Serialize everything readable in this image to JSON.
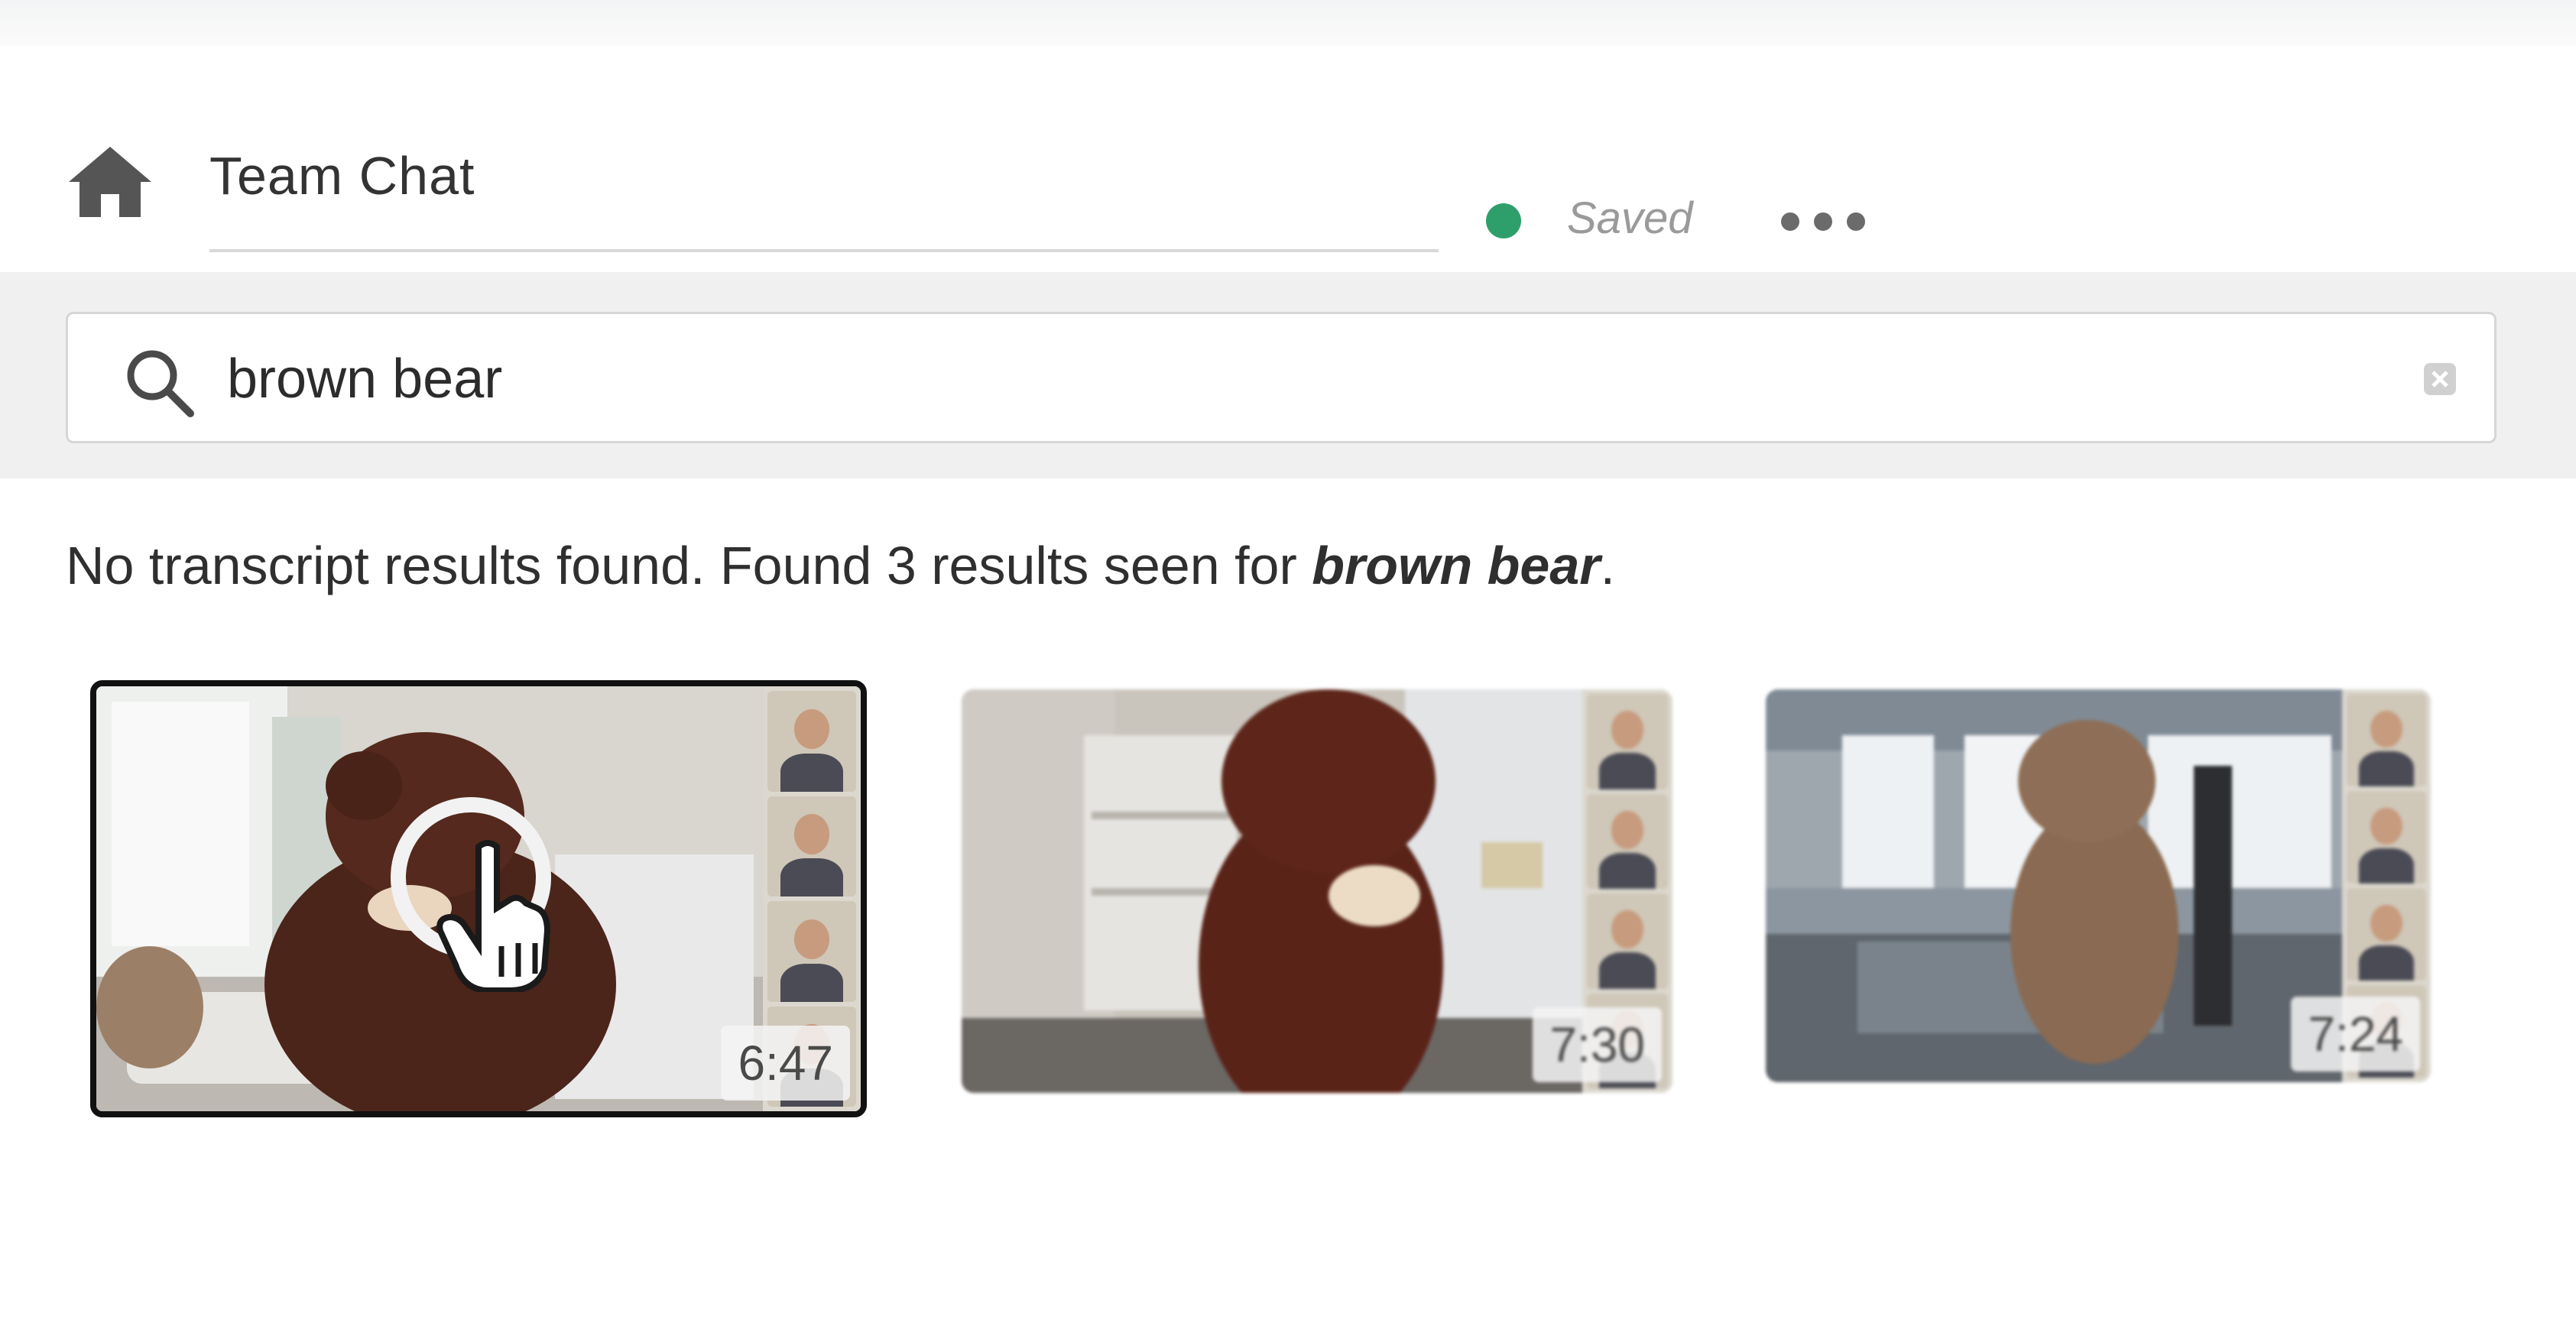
{
  "header": {
    "title": "Team Chat",
    "status_label": "Saved",
    "status_color": "#2e9f6b",
    "home_icon": "home-icon",
    "more_icon": "more-horizontal-icon"
  },
  "search": {
    "value": "brown bear",
    "icon": "search-icon",
    "clear_icon": "close-icon"
  },
  "results": {
    "message_prefix": "No transcript results found. Found 3 results seen for ",
    "query_emphasis": "brown bear",
    "message_suffix": "."
  },
  "videos": [
    {
      "duration": "6:47",
      "selected": true
    },
    {
      "duration": "7:30",
      "selected": false
    },
    {
      "duration": "7:24",
      "selected": false
    }
  ]
}
